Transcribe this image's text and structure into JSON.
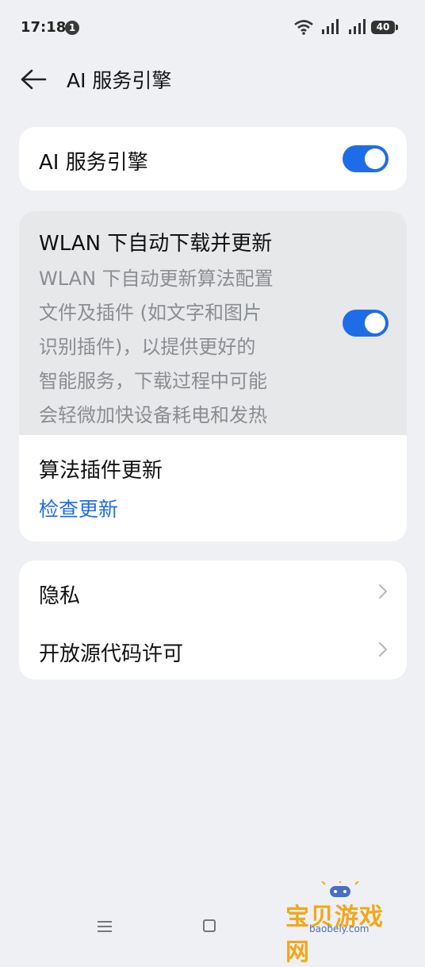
{
  "status_bar": {
    "time": "17:18",
    "notification_count": "1",
    "battery": "40"
  },
  "header": {
    "title": "AI 服务引擎"
  },
  "settings": {
    "ai_engine": {
      "label": "AI 服务引擎",
      "enabled": true
    },
    "wlan_auto_update": {
      "title": "WLAN 下自动下载并更新",
      "description_lines": [
        "WLAN 下自动更新算法配置",
        "文件及插件 (如文字和图片",
        "识别插件)，以提供更好的",
        "智能服务，下载过程中可能",
        "会轻微加快设备耗电和发热"
      ],
      "enabled": true
    },
    "plugin_update": {
      "title": "算法插件更新",
      "action": "检查更新"
    },
    "privacy": {
      "label": "隐私"
    },
    "open_source": {
      "label": "开放源代码许可"
    }
  },
  "watermark": {
    "text": "宝贝游戏网",
    "url": "baobeiy.com"
  },
  "colors": {
    "accent": "#1f6de6",
    "background": "#eef0f3",
    "card": "#ffffff",
    "highlight_row": "#e7e8ea",
    "secondary_text": "#8a8d92"
  }
}
